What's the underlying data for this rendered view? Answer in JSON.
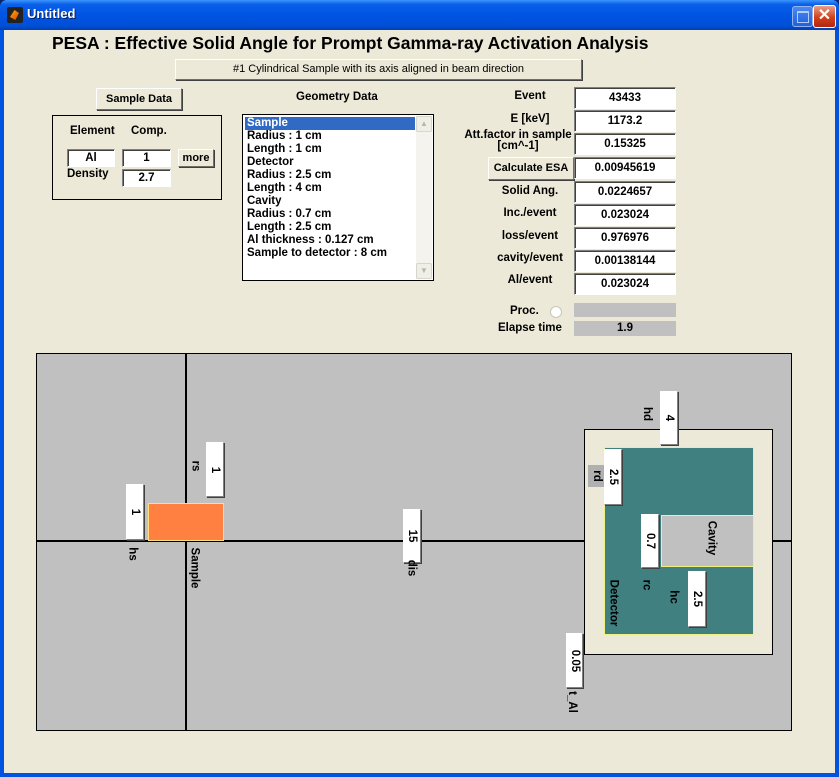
{
  "window": {
    "title": "Untitled",
    "close_glyph": "✕"
  },
  "header": {
    "title": "PESA : Effective Solid Angle for Prompt Gamma-ray Activation Analysis",
    "geometry_type": "#1 Cylindrical Sample with its axis aligned in beam direction"
  },
  "sample_data": {
    "button_label": "Sample Data",
    "element_label": "Element",
    "comp_label": "Comp.",
    "element_value": "Al",
    "comp_value": "1",
    "more_label": "more",
    "density_label": "Density",
    "density_value": "2.7"
  },
  "geometry_data": {
    "label": "Geometry Data",
    "items": [
      "Sample",
      "Radius : 1 cm",
      "Length : 1 cm",
      "Detector",
      "Radius : 2.5 cm",
      "Length : 4 cm",
      "Cavity",
      "Radius : 0.7 cm",
      "Length : 2.5 cm",
      "Al thickness : 0.127 cm",
      "Sample to detector : 8 cm"
    ],
    "selected_index": 0,
    "scroll_up": "▲",
    "scroll_down": "▼"
  },
  "results": {
    "event_label": "Event",
    "event_value": "43433",
    "energy_label": "E [keV]",
    "energy_value": "1173.2",
    "att_label_line1": "Att.factor in sample",
    "att_label_line2": "[cm^-1]",
    "att_value": "0.15325",
    "calc_button": "Calculate ESA",
    "esa_value": "0.00945619",
    "solid_label": "Solid Ang.",
    "solid_value": "0.0224657",
    "inc_label": "Inc./event",
    "inc_value": "0.023024",
    "loss_label": "loss/event",
    "loss_value": "0.976976",
    "cavity_label": "cavity/event",
    "cavity_value": "0.00138144",
    "al_label": "Al/event",
    "al_value": "0.023024",
    "proc_label": "Proc.",
    "proc_value": "",
    "elapse_label": "Elapse time",
    "elapse_value": "1.9"
  },
  "diagram": {
    "hs_label": "hs",
    "hs_value": "1",
    "rs_label": "rs",
    "rs_value": "1",
    "sample_label": "Sample",
    "dis_label": "dis",
    "dis_value": "15",
    "hd_label": "hd",
    "hd_value": "4",
    "rd_label": "rd",
    "rd_value": "2.5",
    "rc_label": "rc",
    "rc_value": "0.7",
    "hc_label": "hc",
    "hc_value": "2.5",
    "cavity_label": "Cavity",
    "detector_label": "Detector",
    "tal_label": "t_Al",
    "tal_value": "0.05",
    "colors": {
      "sample": "#ff8040",
      "detector": "#408080",
      "cavity": "#c0c0c0",
      "background": "#c0c0c0"
    }
  }
}
